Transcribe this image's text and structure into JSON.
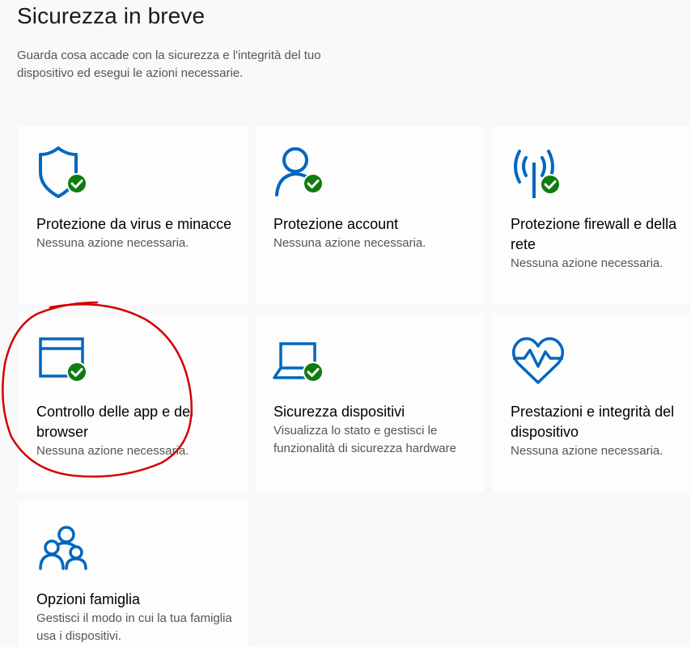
{
  "header": {
    "title": "Sicurezza in breve",
    "description": "Guarda cosa accade con la sicurezza e l'integrità del tuo dispositivo ed esegui le azioni necessarie."
  },
  "colors": {
    "icon_blue": "#0067c0",
    "check_green": "#107c10",
    "annotation_red": "#d40000"
  },
  "tiles": [
    {
      "icon": "shield-icon",
      "title": "Protezione da virus e minacce",
      "status": "Nessuna azione necessaria.",
      "checked": true
    },
    {
      "icon": "account-person-icon",
      "title": "Protezione account",
      "status": "Nessuna azione necessaria.",
      "checked": true
    },
    {
      "icon": "firewall-antenna-icon",
      "title": "Protezione firewall e della rete",
      "status": "Nessuna azione necessaria.",
      "checked": true
    },
    {
      "icon": "app-browser-window-icon",
      "title": "Controllo delle app e del browser",
      "status": "Nessuna azione necessaria.",
      "checked": true
    },
    {
      "icon": "laptop-icon",
      "title": "Sicurezza dispositivi",
      "status": "Visualizza lo stato e gestisci le funzionalità di sicurezza hardware",
      "checked": true
    },
    {
      "icon": "heart-pulse-icon",
      "title": "Prestazioni e integrità del dispositivo",
      "status": "Nessuna azione necessaria.",
      "checked": false
    },
    {
      "icon": "family-icon",
      "title": "Opzioni famiglia",
      "status": "Gestisci il modo in cui la tua famiglia usa i dispositivi.",
      "checked": false
    }
  ]
}
